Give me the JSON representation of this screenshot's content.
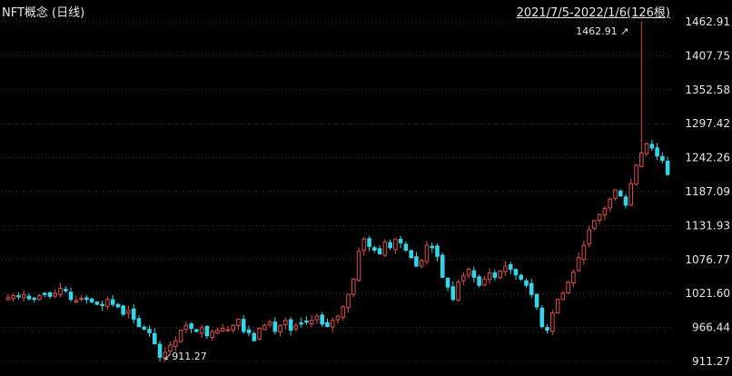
{
  "chart_data": {
    "type": "candlestick",
    "title": "NFT概念 (日线)",
    "range_label": "2021/7/5-2022/1/6(126根)",
    "bar_count": 126,
    "y_ticks": [
      "1462.91",
      "1407.75",
      "1352.58",
      "1297.42",
      "1242.26",
      "1187.09",
      "1131.93",
      "1076.77",
      "1021.60",
      "966.44",
      "911.27"
    ],
    "ylim": [
      911.27,
      1462.91
    ],
    "grid": true,
    "annotations": {
      "high": {
        "label": "1462.91",
        "value": 1462.91,
        "bar_index": 121
      },
      "low": {
        "label": "911.27",
        "value": 911.27,
        "bar_index": 29
      }
    },
    "colors": {
      "up": "#e04a4a",
      "down": "#33d6e8",
      "grid": "#3a3a3a",
      "text": "#e6e6e6",
      "background": "#000000"
    },
    "close": [
      1015,
      1018,
      1016,
      1020,
      1013,
      1012,
      1018,
      1020,
      1017,
      1022,
      1030,
      1026,
      1012,
      1010,
      1014,
      1012,
      1008,
      1004,
      1002,
      1012,
      1004,
      1000,
      988,
      994,
      980,
      968,
      964,
      958,
      940,
      918,
      926,
      938,
      945,
      962,
      970,
      965,
      960,
      966,
      953,
      960,
      962,
      965,
      963,
      970,
      980,
      960,
      958,
      945,
      965,
      970,
      975,
      960,
      970,
      978,
      962,
      970,
      972,
      975,
      978,
      985,
      972,
      968,
      978,
      985,
      1000,
      1020,
      1045,
      1090,
      1110,
      1098,
      1092,
      1086,
      1105,
      1096,
      1110,
      1104,
      1092,
      1080,
      1066,
      1075,
      1100,
      1096,
      1082,
      1048,
      1032,
      1012,
      1040,
      1050,
      1061,
      1048,
      1035,
      1045,
      1055,
      1048,
      1058,
      1066,
      1061,
      1052,
      1045,
      1035,
      1020,
      1000,
      968,
      962,
      990,
      1012,
      1022,
      1040,
      1056,
      1080,
      1100,
      1125,
      1140,
      1150,
      1160,
      1175,
      1190,
      1180,
      1165,
      1200,
      1230,
      1250,
      1265,
      1258,
      1245,
      1238,
      1215
    ],
    "markers_note": ""
  }
}
